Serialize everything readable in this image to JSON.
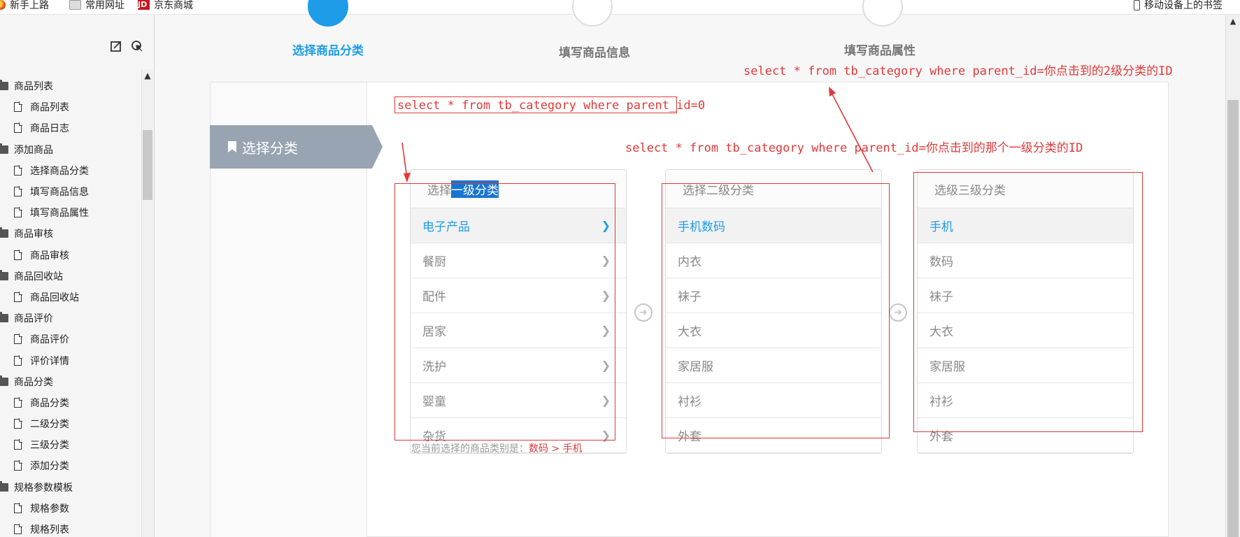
{
  "bookmarks": [
    {
      "label": "新手上路",
      "icon": "firefox-icon"
    },
    {
      "label": "常用网址",
      "icon": "folder-icon"
    },
    {
      "label": "京东商城",
      "icon": "jd-icon"
    }
  ],
  "mobile_bookmarks": "移动设备上的书签",
  "sidebar": {
    "tools": [
      "export-icon",
      "locate-icon"
    ],
    "tree": [
      {
        "type": "group",
        "label": "商品列表"
      },
      {
        "type": "leaf",
        "label": "商品列表"
      },
      {
        "type": "leaf",
        "label": "商品日志"
      },
      {
        "type": "group",
        "label": "添加商品"
      },
      {
        "type": "leaf",
        "label": "选择商品分类"
      },
      {
        "type": "leaf",
        "label": "填写商品信息"
      },
      {
        "type": "leaf",
        "label": "填写商品属性"
      },
      {
        "type": "group",
        "label": "商品审核"
      },
      {
        "type": "leaf",
        "label": "商品审核"
      },
      {
        "type": "group",
        "label": "商品回收站"
      },
      {
        "type": "leaf",
        "label": "商品回收站"
      },
      {
        "type": "group",
        "label": "商品评价"
      },
      {
        "type": "leaf",
        "label": "商品评价"
      },
      {
        "type": "leaf",
        "label": "评价详情"
      },
      {
        "type": "group",
        "label": "商品分类"
      },
      {
        "type": "leaf",
        "label": "商品分类"
      },
      {
        "type": "leaf",
        "label": "二级分类"
      },
      {
        "type": "leaf",
        "label": "三级分类"
      },
      {
        "type": "leaf",
        "label": "添加分类"
      },
      {
        "type": "group",
        "label": "规格参数模板"
      },
      {
        "type": "leaf",
        "label": "规格参数"
      },
      {
        "type": "leaf",
        "label": "规格列表"
      }
    ]
  },
  "steps": [
    {
      "label": "选择商品分类",
      "active": true
    },
    {
      "label": "填写商品信息",
      "active": false
    },
    {
      "label": "填写商品属性",
      "active": false
    }
  ],
  "tab": {
    "label": "选择分类"
  },
  "columns": [
    {
      "head_pre": "选择",
      "head_hl": "一级分类",
      "items": [
        "电子产品",
        "餐厨",
        "配件",
        "居家",
        "洗护",
        "婴童",
        "杂货"
      ],
      "selected": 0,
      "chevrons": true
    },
    {
      "head_pre": "选择二级分类",
      "head_hl": "",
      "items": [
        "手机数码",
        "内衣",
        "袜子",
        "大衣",
        "家居服",
        "衬衫",
        "外套"
      ],
      "selected": 0,
      "chevrons": false
    },
    {
      "head_pre": "选级三级分类",
      "head_hl": "",
      "items": [
        "手机",
        "数码",
        "袜子",
        "大衣",
        "家居服",
        "衬衫",
        "外套"
      ],
      "selected": 0,
      "chevrons": false
    }
  ],
  "current_selection": {
    "prefix": "您当前选择的商品类别是：",
    "path": "数码 > 手机"
  },
  "annotations": {
    "sql_level1": "select * from tb_category where parent_id=0",
    "sql_level2": "select * from tb_category where parent_id=你点击到的那个一级分类的ID",
    "sql_level3": "select * from tb_category where parent_id=你点击到的2级分类的ID",
    "color": "#e23838"
  },
  "colors": {
    "accent": "#1e9ce8",
    "annotation": "#e23838",
    "tab": "#98a4b1"
  }
}
